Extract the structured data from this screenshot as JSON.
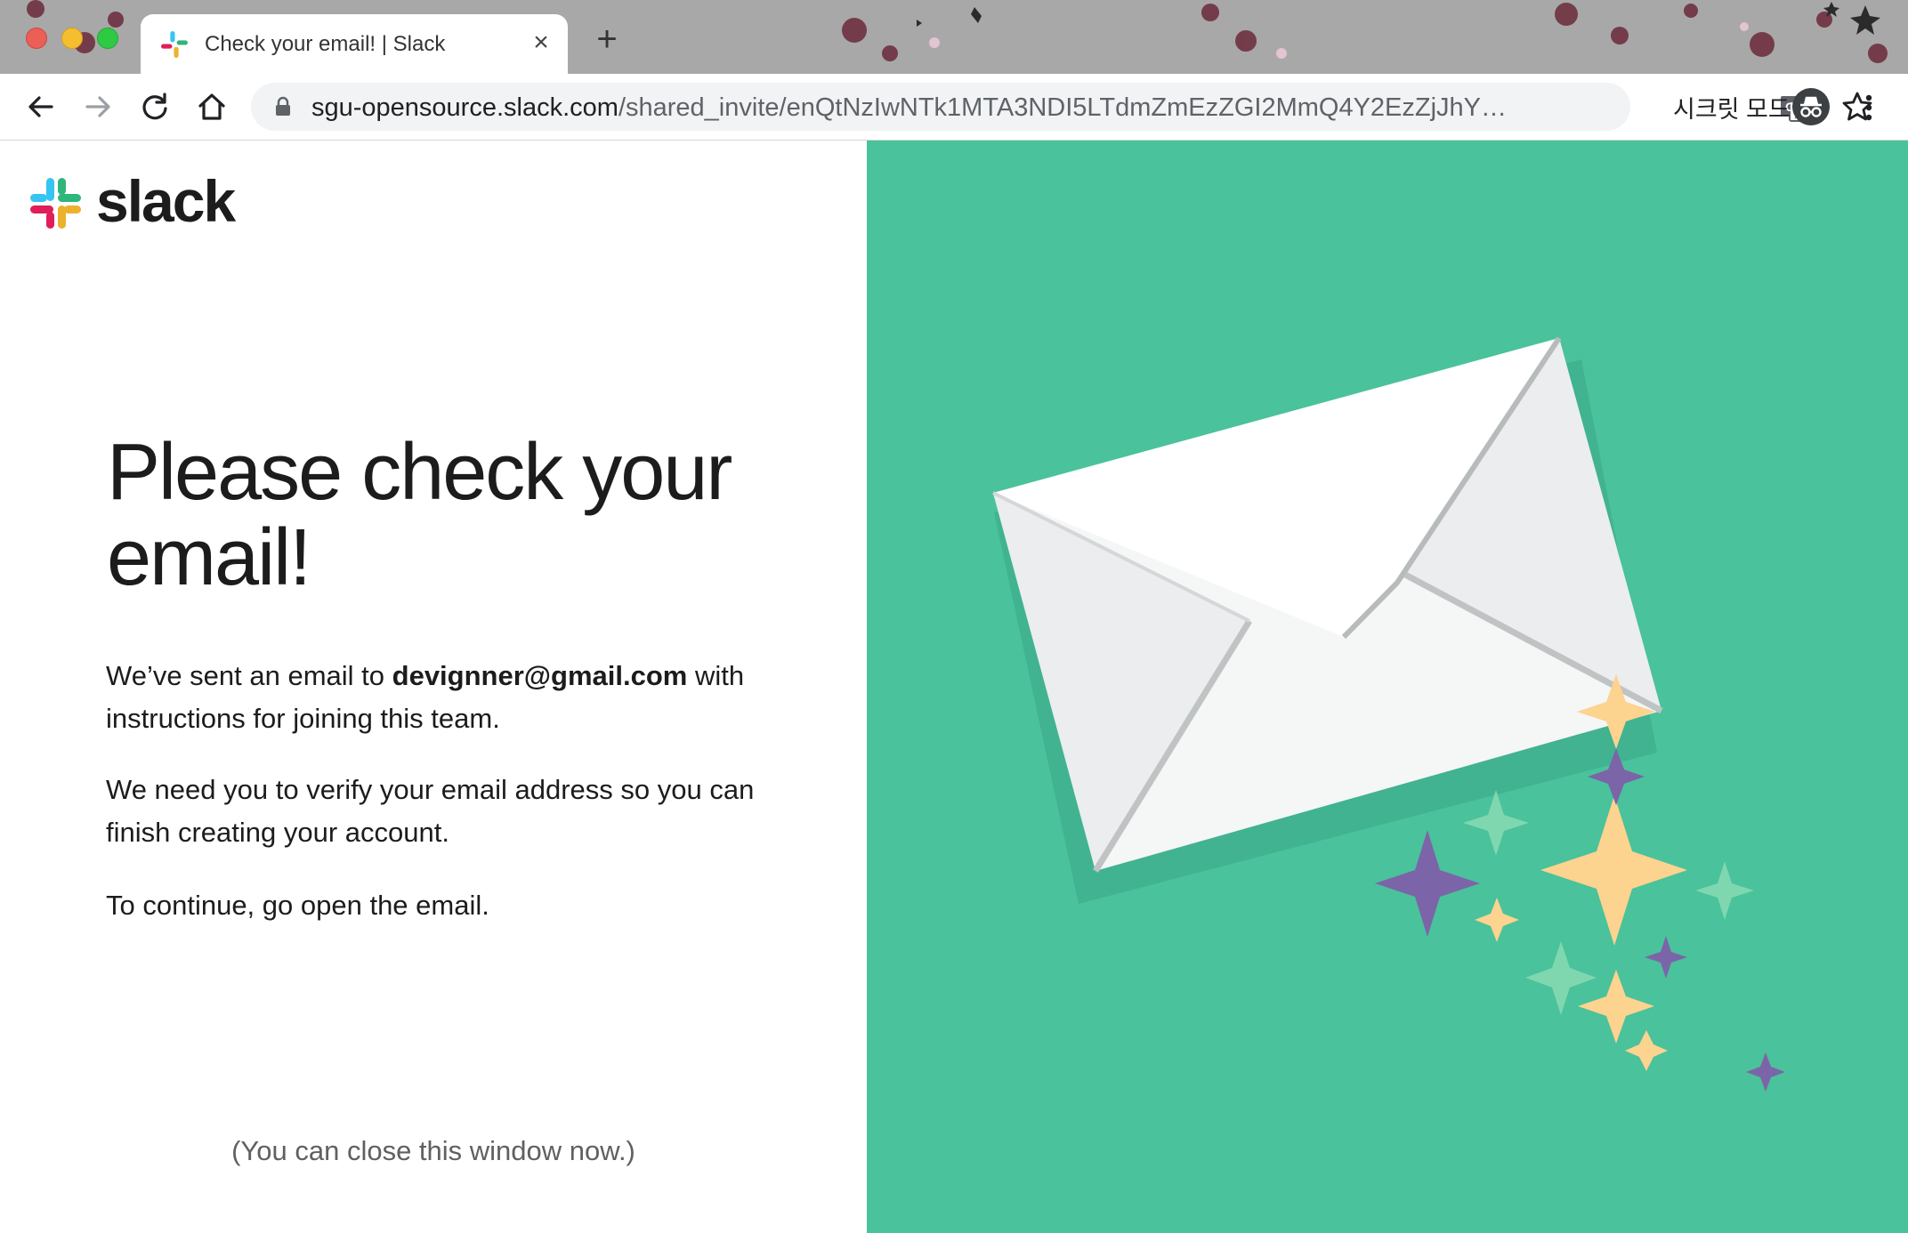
{
  "browser": {
    "tab_title": "Check your email! | Slack",
    "tab_close_glyph": "×",
    "new_tab_glyph": "+",
    "url_domain": "sgu-opensource.slack.com",
    "url_path": "/shared_invite/enQtNzIwNTk1MTA3NDI5LTdmZmEzZGI2MmQ4Y2EzZjJhY…",
    "incognito_label": "시크릿 모드",
    "icons": [
      "back-arrow-icon",
      "forward-arrow-icon",
      "reload-icon",
      "home-icon",
      "lock-icon",
      "translate-icon",
      "star-icon",
      "incognito-icon",
      "menu-dots-icon"
    ]
  },
  "page": {
    "logo_text": "slack",
    "heading": "Please check your email!",
    "para1_before": "We’ve sent an email to ",
    "para1_email": "devignner@gmail.com",
    "para1_after": " with instructions for joining this team.",
    "para2": "We need you to verify your email address so you can finish creating your account.",
    "para3": "To continue, go open the email.",
    "close_note": "(You can close this window now.)"
  },
  "colors": {
    "panel_green": "#4ac29b",
    "sparkle_yellow": "#fcd38f",
    "sparkle_purple": "#7c64a8",
    "sparkle_mint": "#7fd7b0"
  }
}
